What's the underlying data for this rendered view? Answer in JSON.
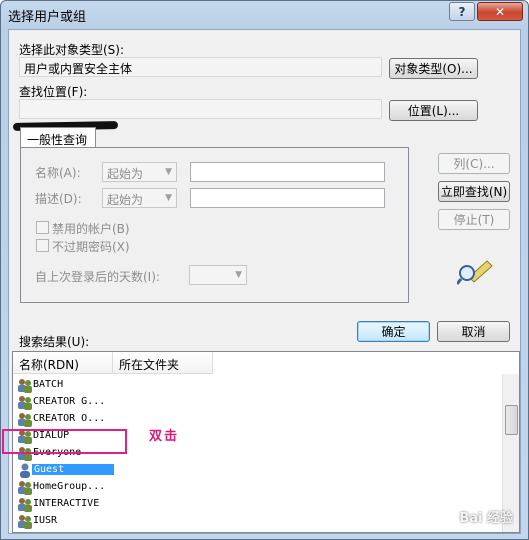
{
  "window": {
    "title": "选择用户或组",
    "help_label": "?",
    "close_label": "✕"
  },
  "object_type": {
    "label": "选择此对象类型(S):",
    "value": "用户或内置安全主体",
    "button": "对象类型(O)..."
  },
  "location": {
    "label": "查找位置(F):",
    "value": "",
    "button": "位置(L)..."
  },
  "query": {
    "tab_label": "一般性查询",
    "name_label": "名称(A):",
    "name_mode": "起始为",
    "desc_label": "描述(D):",
    "desc_mode": "起始为",
    "disabled_accounts": "禁用的帐户(B)",
    "non_expiring": "不过期密码(X)",
    "days_label": "自上次登录后的天数(I):",
    "col_button": "列(C)...",
    "find_button": "立即查找(N)",
    "stop_button": "停止(T)"
  },
  "actions": {
    "ok": "确定",
    "cancel": "取消"
  },
  "results": {
    "label": "搜索结果(U):",
    "columns": [
      "名称(RDN)",
      "所在文件夹"
    ],
    "rows": [
      {
        "name": "BATCH"
      },
      {
        "name": "CREATOR G..."
      },
      {
        "name": "CREATOR O..."
      },
      {
        "name": "DIALUP"
      },
      {
        "name": "Everyone"
      },
      {
        "name": "Guest"
      },
      {
        "name": "HomeGroup..."
      },
      {
        "name": "INTERACTIVE"
      },
      {
        "name": "IUSR"
      }
    ]
  },
  "annotation": "双击",
  "watermark": "Bai 经验",
  "colors": {
    "highlight": "#e0208a",
    "selection": "#3399ff",
    "annotation": "#d81a7a"
  }
}
